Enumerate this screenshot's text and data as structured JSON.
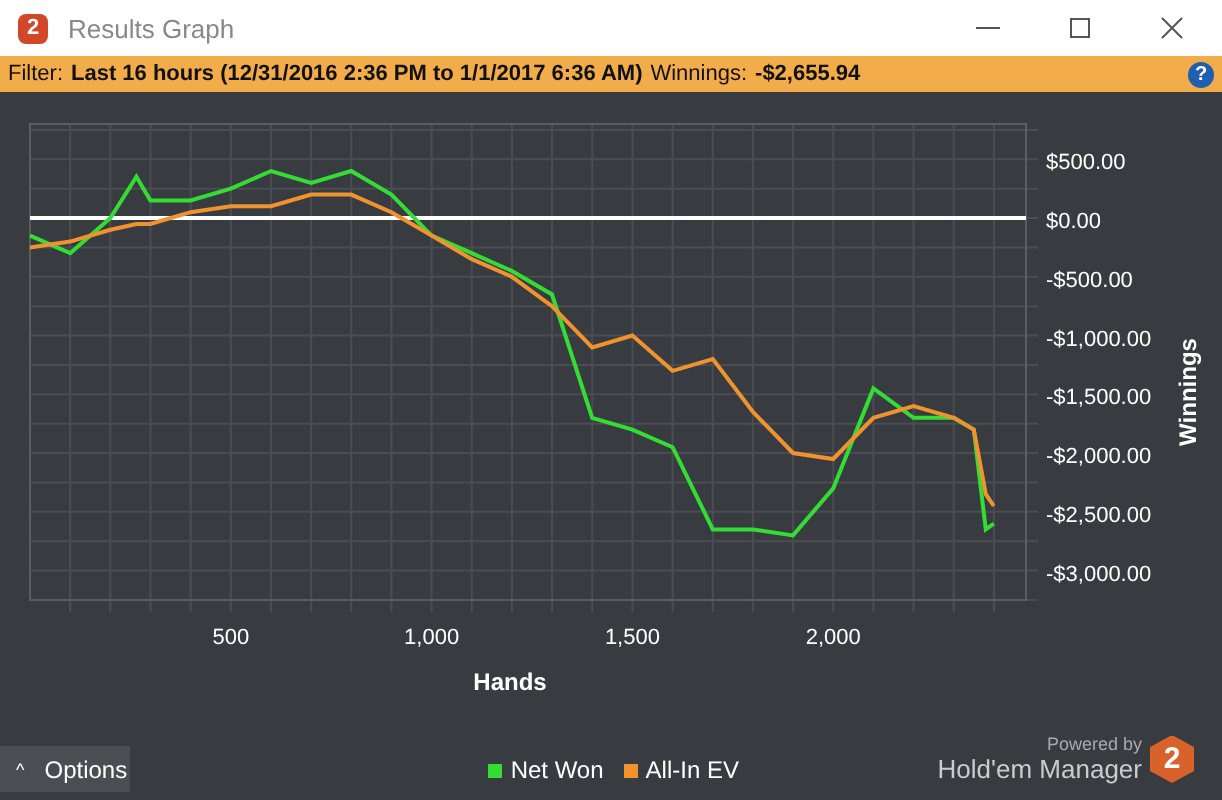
{
  "window": {
    "title": "Results Graph",
    "logo": "2"
  },
  "filter_bar": {
    "label": "Filter:",
    "filter": "Last 16 hours (12/31/2016 2:36 PM to 1/1/2017 6:36 AM)",
    "winnings_label": "Winnings:",
    "winnings": "-$2,655.94",
    "help": "?"
  },
  "chart": {
    "chart_data": {
      "type": "line",
      "xlabel": "Hands",
      "ylabel": "Winnings",
      "xlim": [
        0,
        2480
      ],
      "ylim": [
        -3250,
        800
      ],
      "xticks": [
        {
          "value": 500,
          "label": "500"
        },
        {
          "value": 1000,
          "label": "1,000"
        },
        {
          "value": 1500,
          "label": "1,500"
        },
        {
          "value": 2000,
          "label": "2,000"
        }
      ],
      "yticks": [
        {
          "value": 500,
          "label": "$500.00"
        },
        {
          "value": 0,
          "label": "$0.00"
        },
        {
          "value": -500,
          "label": "-$500.00"
        },
        {
          "value": -1000,
          "label": "-$1,000.00"
        },
        {
          "value": -1500,
          "label": "-$1,500.00"
        },
        {
          "value": -2000,
          "label": "-$2,000.00"
        },
        {
          "value": -2500,
          "label": "-$2,500.00"
        },
        {
          "value": -3000,
          "label": "-$3,000.00"
        }
      ],
      "x": [
        0,
        100,
        200,
        265,
        300,
        400,
        500,
        600,
        700,
        800,
        900,
        1000,
        1100,
        1200,
        1300,
        1400,
        1500,
        1600,
        1700,
        1800,
        1900,
        2000,
        2100,
        2200,
        2300,
        2350,
        2380,
        2400
      ],
      "series": [
        {
          "name": "Net Won",
          "color": "#33dd33",
          "values": [
            -150,
            -300,
            0,
            350,
            150,
            150,
            250,
            400,
            300,
            400,
            200,
            -150,
            -300,
            -450,
            -650,
            -1700,
            -1800,
            -1950,
            -2650,
            -2650,
            -2700,
            -2300,
            -1450,
            -1700,
            -1700,
            -1800,
            -2650,
            -2600
          ]
        },
        {
          "name": "All-In EV",
          "color": "#f0922e",
          "values": [
            -250,
            -200,
            -100,
            -50,
            -50,
            50,
            100,
            100,
            200,
            200,
            50,
            -150,
            -350,
            -500,
            -750,
            -1100,
            -1000,
            -1300,
            -1200,
            -1650,
            -2000,
            -2050,
            -1700,
            -1600,
            -1700,
            -1800,
            -2350,
            -2450
          ]
        }
      ],
      "grid": true
    }
  },
  "options_button": {
    "caret": "^",
    "label": "Options"
  },
  "branding": {
    "powered_by": "Powered by",
    "product": "Hold'em Manager",
    "logo": "2"
  }
}
